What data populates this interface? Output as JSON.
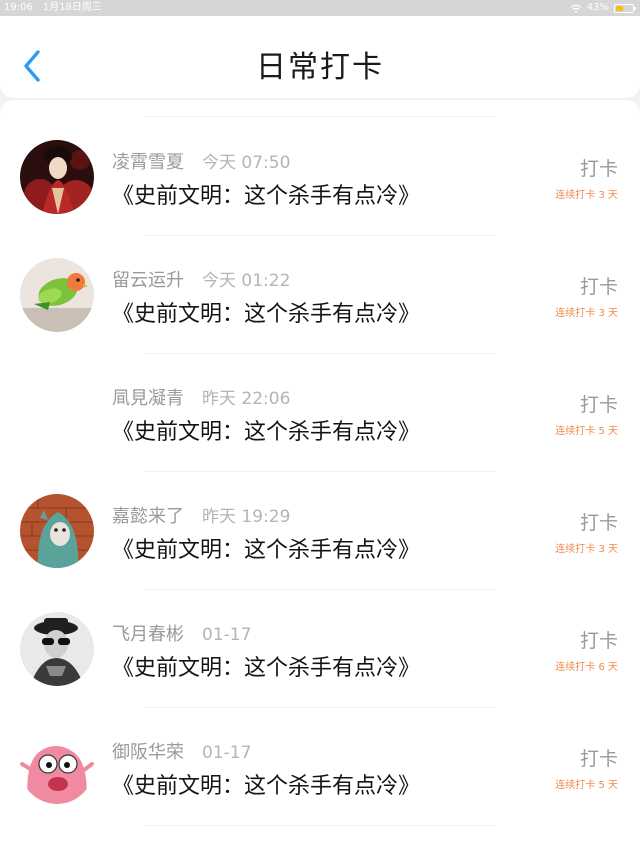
{
  "status_bar": {
    "time": "19:06",
    "date": "1月18日周三",
    "battery": "43%",
    "battery_level": 0.43,
    "wifi_icon": "wifi-icon",
    "battery_icon": "battery-icon"
  },
  "header": {
    "title": "日常打卡",
    "back_icon": "chevron-left-icon",
    "accent_color": "#2f9bf0"
  },
  "checkins": [
    {
      "user": "凌霄雪夏",
      "time": "今天 07:50",
      "book": "《史前文明：这个杀手有点冷》",
      "action": "打卡",
      "streak": "连续打卡 3 天",
      "avatar": "avatar-woman-red-dress"
    },
    {
      "user": "留云运升",
      "time": "今天 01:22",
      "book": "《史前文明：这个杀手有点冷》",
      "action": "打卡",
      "streak": "连续打卡 3 天",
      "avatar": "avatar-green-parrot"
    },
    {
      "user": "凬見凝青",
      "time": "昨天 22:06",
      "book": "《史前文明：这个杀手有点冷》",
      "action": "打卡",
      "streak": "连续打卡 5 天",
      "avatar": "avatar-blank"
    },
    {
      "user": "嘉懿来了",
      "time": "昨天 19:29",
      "book": "《史前文明：这个杀手有点冷》",
      "action": "打卡",
      "streak": "连续打卡 3 天",
      "avatar": "avatar-hooded-figure"
    },
    {
      "user": "飞月春彬",
      "time": "01-17",
      "book": "《史前文明：这个杀手有点冷》",
      "action": "打卡",
      "streak": "连续打卡 6 天",
      "avatar": "avatar-woman-sunglasses"
    },
    {
      "user": "御阪华荣",
      "time": "01-17",
      "book": "《史前文明：这个杀手有点冷》",
      "action": "打卡",
      "streak": "连续打卡 5 天",
      "avatar": "avatar-pink-cartoon"
    }
  ],
  "colors": {
    "streak": "#f08a4b",
    "muted": "#9a9a9a",
    "background": "#f2f2f4"
  }
}
